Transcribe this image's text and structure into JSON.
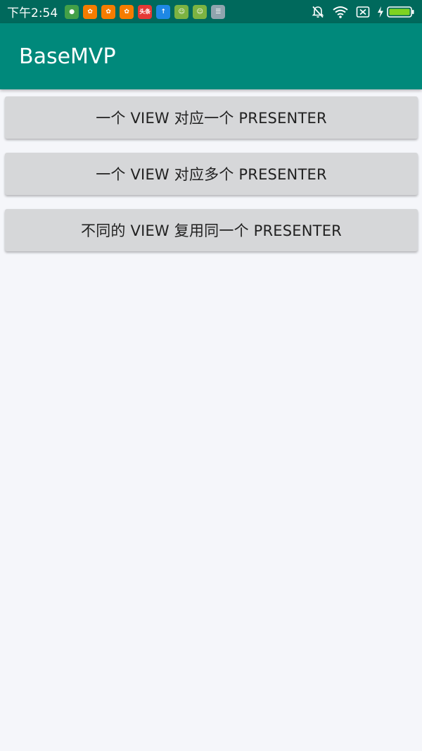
{
  "status_bar": {
    "time": "下午2:54",
    "notification_icons": [
      {
        "name": "shield-app-icon",
        "color": "#43A047",
        "glyph": "●"
      },
      {
        "name": "squirrel-app-icon",
        "color": "#F57C00",
        "glyph": "✿"
      },
      {
        "name": "squirrel-app-icon-2",
        "color": "#F57C00",
        "glyph": "✿"
      },
      {
        "name": "squirrel-app-icon-3",
        "color": "#F57C00",
        "glyph": "✿"
      },
      {
        "name": "toutiao-app-icon",
        "color": "#E53935",
        "glyph": "头条"
      },
      {
        "name": "upload-app-icon",
        "color": "#1E88E5",
        "glyph": "↑"
      },
      {
        "name": "android-app-icon",
        "color": "#7CB342",
        "glyph": "☺"
      },
      {
        "name": "android-app-icon-2",
        "color": "#7CB342",
        "glyph": "☺"
      },
      {
        "name": "message-app-icon",
        "color": "#90A4AE",
        "glyph": "☰"
      }
    ],
    "right_icons": [
      "mute-bell-icon",
      "wifi-icon",
      "no-sim-icon",
      "charging-icon",
      "battery-icon"
    ]
  },
  "app_bar": {
    "title": "BaseMVP",
    "color": "#00897B"
  },
  "buttons": [
    {
      "label": "一个 VIEW 对应一个 PRESENTER"
    },
    {
      "label": "一个 VIEW 对应多个 PRESENTER"
    },
    {
      "label": "不同的 VIEW 复用同一个 PRESENTER"
    }
  ]
}
